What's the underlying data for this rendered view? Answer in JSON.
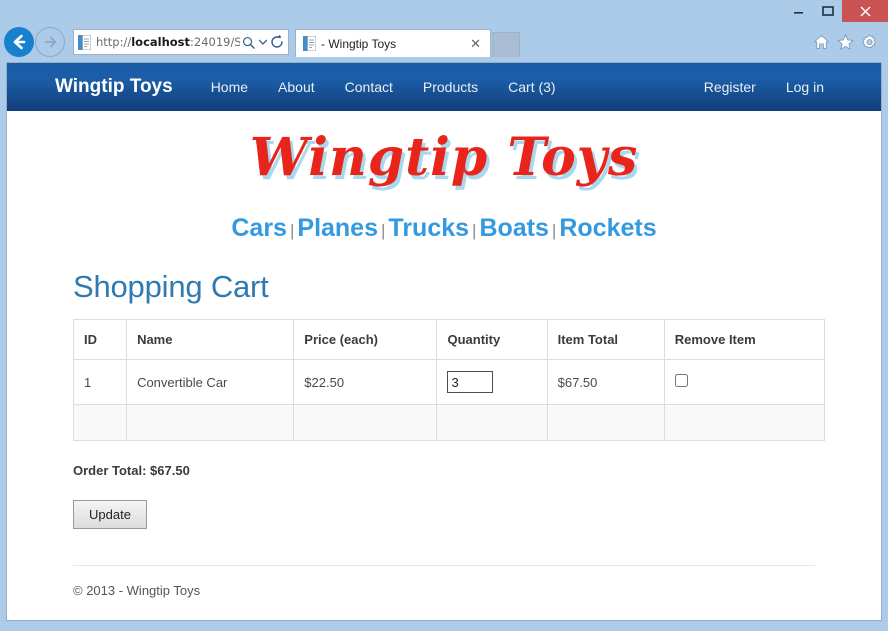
{
  "browser": {
    "window_controls": {
      "minimize": "–",
      "maximize": "❐",
      "close": "✕"
    },
    "back_icon": "←",
    "forward_icon": "→",
    "address": {
      "url_protocol": "http://",
      "url_host": "localhost",
      "url_rest": ":24019/S",
      "search_icon": "⚲",
      "dropdown_icon": "▾",
      "refresh_icon": "↻"
    },
    "tab": {
      "title": "- Wingtip Toys",
      "close_icon": "✕"
    },
    "toolbar_icons": {
      "home": "⌂",
      "favorites": "★",
      "settings": "⚙"
    }
  },
  "sitenav": {
    "brand": "Wingtip Toys",
    "links": [
      {
        "label": "Home"
      },
      {
        "label": "About"
      },
      {
        "label": "Contact"
      },
      {
        "label": "Products"
      },
      {
        "label": "Cart (3)"
      }
    ],
    "account_links": [
      {
        "label": "Register"
      },
      {
        "label": "Log in"
      }
    ]
  },
  "logo": {
    "text": "Wingtip Toys",
    "color": "#e8241b",
    "shadow_color": "#a8d8ef"
  },
  "categories": {
    "separator": "|",
    "color": "#3399e0",
    "items": [
      {
        "label": "Cars"
      },
      {
        "label": "Planes"
      },
      {
        "label": "Trucks"
      },
      {
        "label": "Boats"
      },
      {
        "label": "Rockets"
      }
    ]
  },
  "main": {
    "page_title": "Shopping Cart",
    "page_title_color": "#2f7ab0",
    "table": {
      "headers": [
        "ID",
        "Name",
        "Price (each)",
        "Quantity",
        "Item Total",
        "Remove Item"
      ],
      "rows": [
        {
          "id": "1",
          "name": "Convertible Car",
          "price": "$22.50",
          "quantity": "3",
          "item_total": "$67.50",
          "remove_checked": false
        }
      ]
    },
    "order_total": "Order Total: $67.50",
    "update_button": "Update"
  },
  "footer": {
    "copyright": "© 2013 - Wingtip Toys"
  }
}
